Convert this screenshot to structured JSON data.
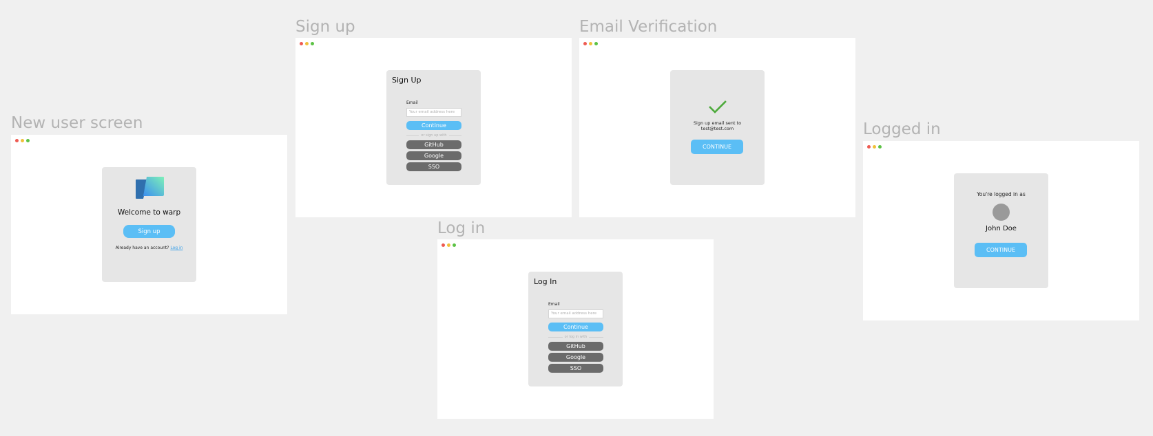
{
  "frames": {
    "new_user": {
      "title": "New user screen",
      "card": {
        "welcome": "Welcome to warp",
        "signup_button": "Sign up",
        "account_prompt": "Already have an account?",
        "login_link": "Log in"
      }
    },
    "signup": {
      "title": "Sign up",
      "card": {
        "heading": "Sign Up",
        "email_label": "Email",
        "email_placeholder": "Your email address here",
        "continue_button": "Continue",
        "divider_text": "or sign up with",
        "github_button": "GitHub",
        "google_button": "Google",
        "sso_button": "SSO"
      }
    },
    "verification": {
      "title": "Email Verification",
      "card": {
        "message_line1": "Sign up email sent to",
        "message_line2": "test@test.com",
        "continue_button": "CONTINUE"
      }
    },
    "login": {
      "title": "Log in",
      "card": {
        "heading": "Log In",
        "email_label": "Email",
        "email_placeholder": "Your email address here",
        "continue_button": "Continue",
        "divider_text": "or log in with",
        "github_button": "GitHub",
        "google_button": "Google",
        "sso_button": "SSO"
      }
    },
    "logged_in": {
      "title": "Logged in",
      "card": {
        "status_text": "You're logged in as",
        "user_name": "John Doe",
        "continue_button": "CONTINUE"
      }
    }
  },
  "colors": {
    "canvas_bg": "#f0f0f0",
    "window_bg": "#ffffff",
    "card_bg": "#e6e6e6",
    "primary_button": "#5bbef5",
    "social_button": "#6b6b6b",
    "check_mark": "#4caa3a",
    "avatar": "#9a9a9a",
    "traffic_red": "#ee5b52",
    "traffic_yellow": "#f0c03a",
    "traffic_green": "#5cc245"
  },
  "icons": {
    "window_controls": [
      "close-dot",
      "minimize-dot",
      "zoom-dot"
    ],
    "logo": "warp-logo",
    "verification": "checkmark-icon",
    "user": "avatar"
  }
}
